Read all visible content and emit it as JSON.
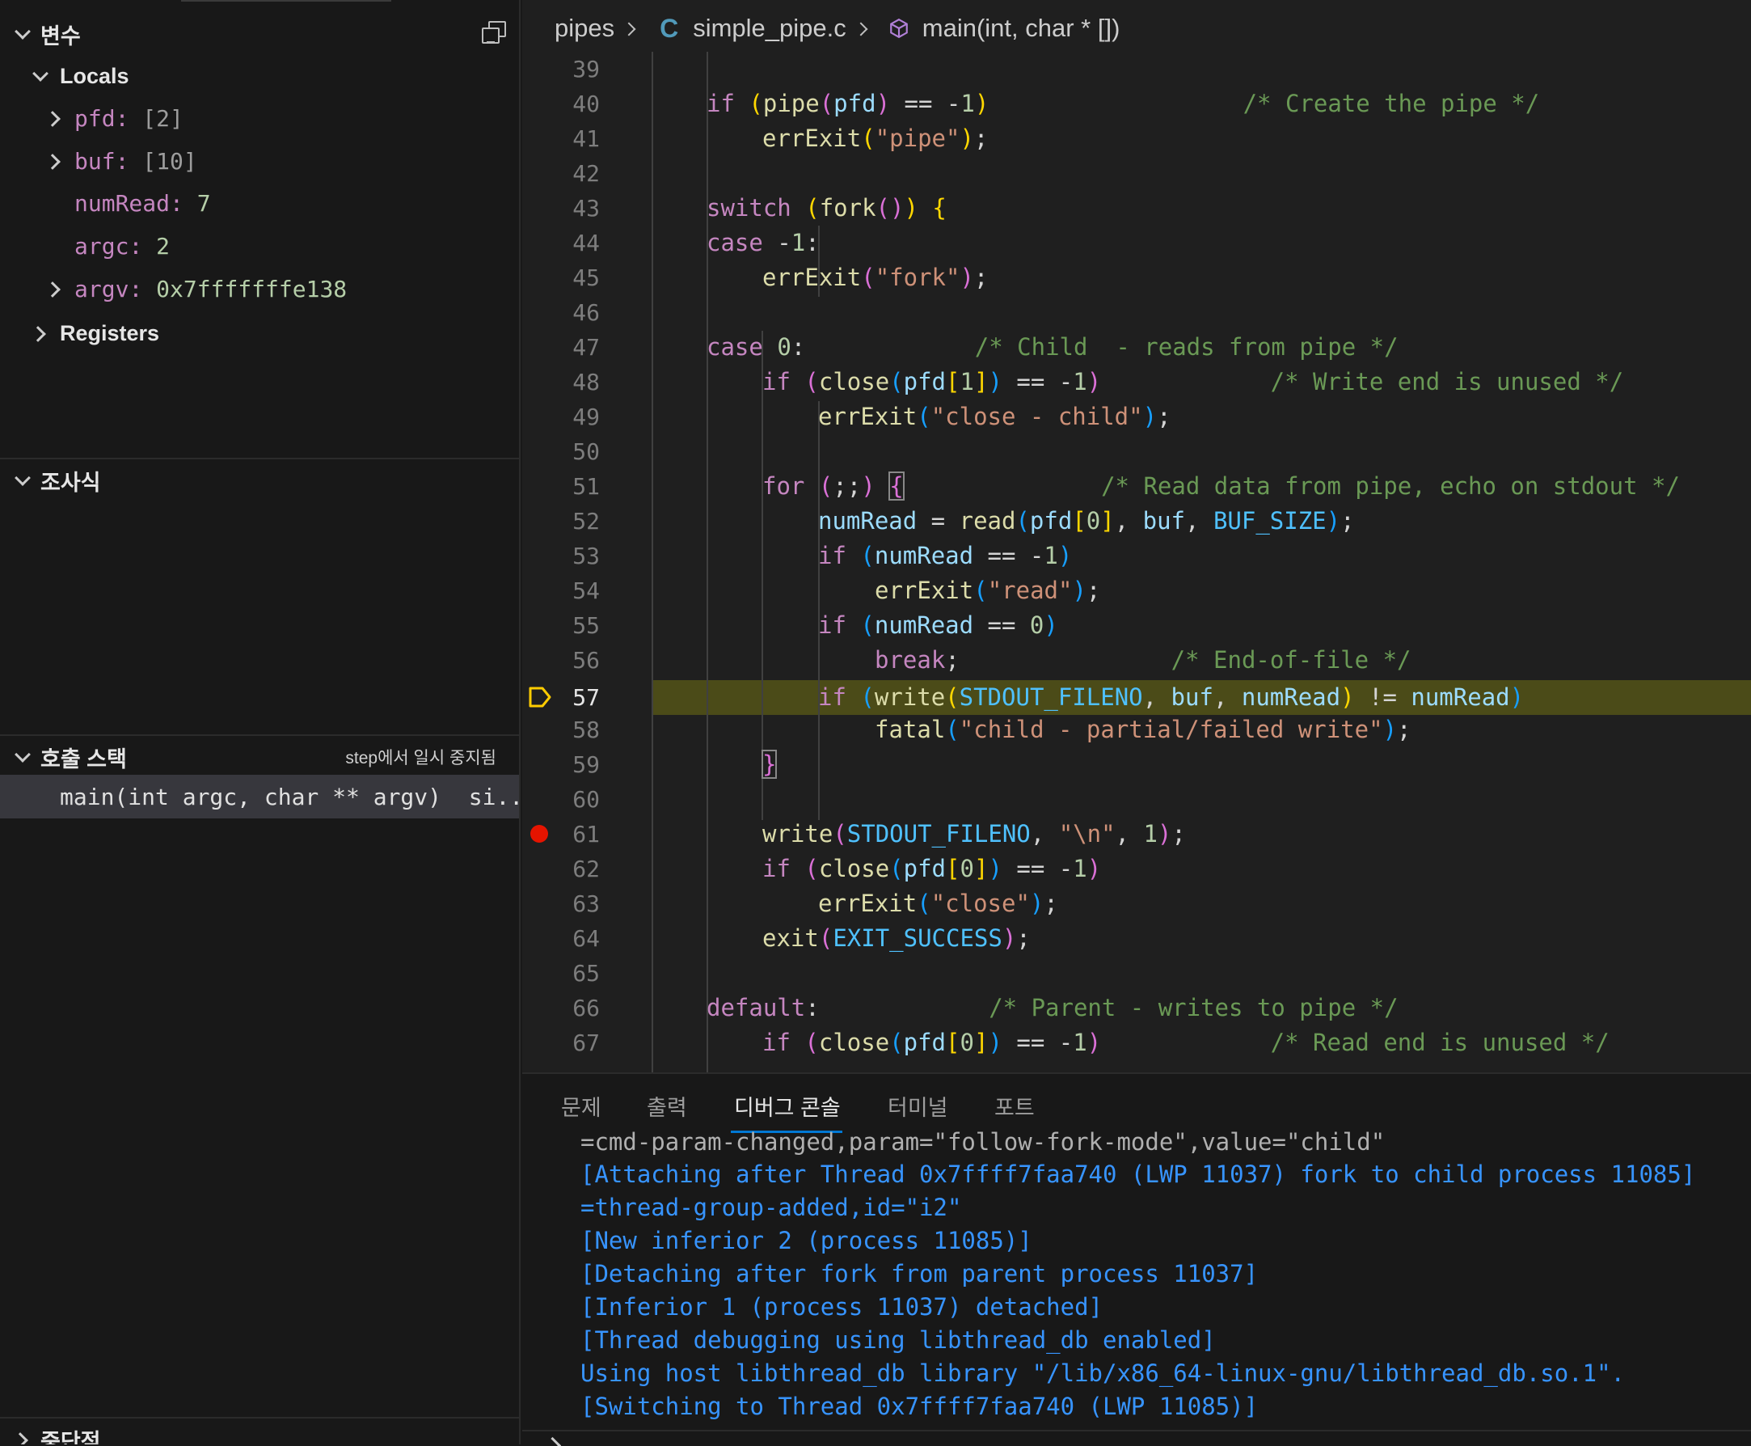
{
  "sidebar": {
    "variables": {
      "title": "변수",
      "locals": {
        "label": "Locals",
        "items": [
          {
            "name": "pfd",
            "value": "[2]",
            "expandable": true
          },
          {
            "name": "buf",
            "value": "[10]",
            "expandable": true
          },
          {
            "name": "numRead",
            "value": "7",
            "expandable": false
          },
          {
            "name": "argc",
            "value": "2",
            "expandable": false
          },
          {
            "name": "argv",
            "value": "0x7fffffffe138",
            "expandable": true
          }
        ]
      },
      "registers_label": "Registers"
    },
    "watch": {
      "title": "조사식"
    },
    "call_stack": {
      "title": "호출 스택",
      "status": "step에서 일시 중지됨",
      "frames": [
        {
          "label": "main(int argc, char ** argv)  si..."
        }
      ]
    },
    "breakpoints": {
      "title": "중단점"
    }
  },
  "editor": {
    "breadcrumb": {
      "folder": "pipes",
      "lang_icon": "C",
      "file": "simple_pipe.c",
      "symbol": "main(int, char * [])"
    },
    "current_line": 57,
    "breakpoint_line": 61,
    "line_numbers": [
      "39",
      "40",
      "41",
      "42",
      "43",
      "44",
      "45",
      "46",
      "47",
      "48",
      "49",
      "50",
      "51",
      "52",
      "53",
      "54",
      "55",
      "56",
      "57",
      "58",
      "59",
      "60",
      "61",
      "62",
      "63",
      "64",
      "65",
      "66",
      "67"
    ],
    "colors": {
      "highlight": "#4b4b18",
      "breakpoint": "#e51400",
      "arrow": "#ffcc00"
    }
  },
  "panel": {
    "tabs": [
      "문제",
      "출력",
      "디버그 콘솔",
      "터미널",
      "포트"
    ],
    "active_tab": "디버그 콘솔",
    "console_lines": [
      "=cmd-param-changed,param=\"follow-fork-mode\",value=\"child\"",
      "[Attaching after Thread 0x7ffff7faa740 (LWP 11037) fork to child process 11085]",
      "=thread-group-added,id=\"i2\"",
      "[New inferior 2 (process 11085)]",
      "[Detaching after fork from parent process 11037]",
      "[Inferior 1 (process 11037) detached]",
      "[Thread debugging using libthread_db enabled]",
      "Using host libthread_db library \"/lib/x86_64-linux-gnu/libthread_db.so.1\".",
      "[Switching to Thread 0x7ffff7faa740 (LWP 11085)]"
    ]
  }
}
